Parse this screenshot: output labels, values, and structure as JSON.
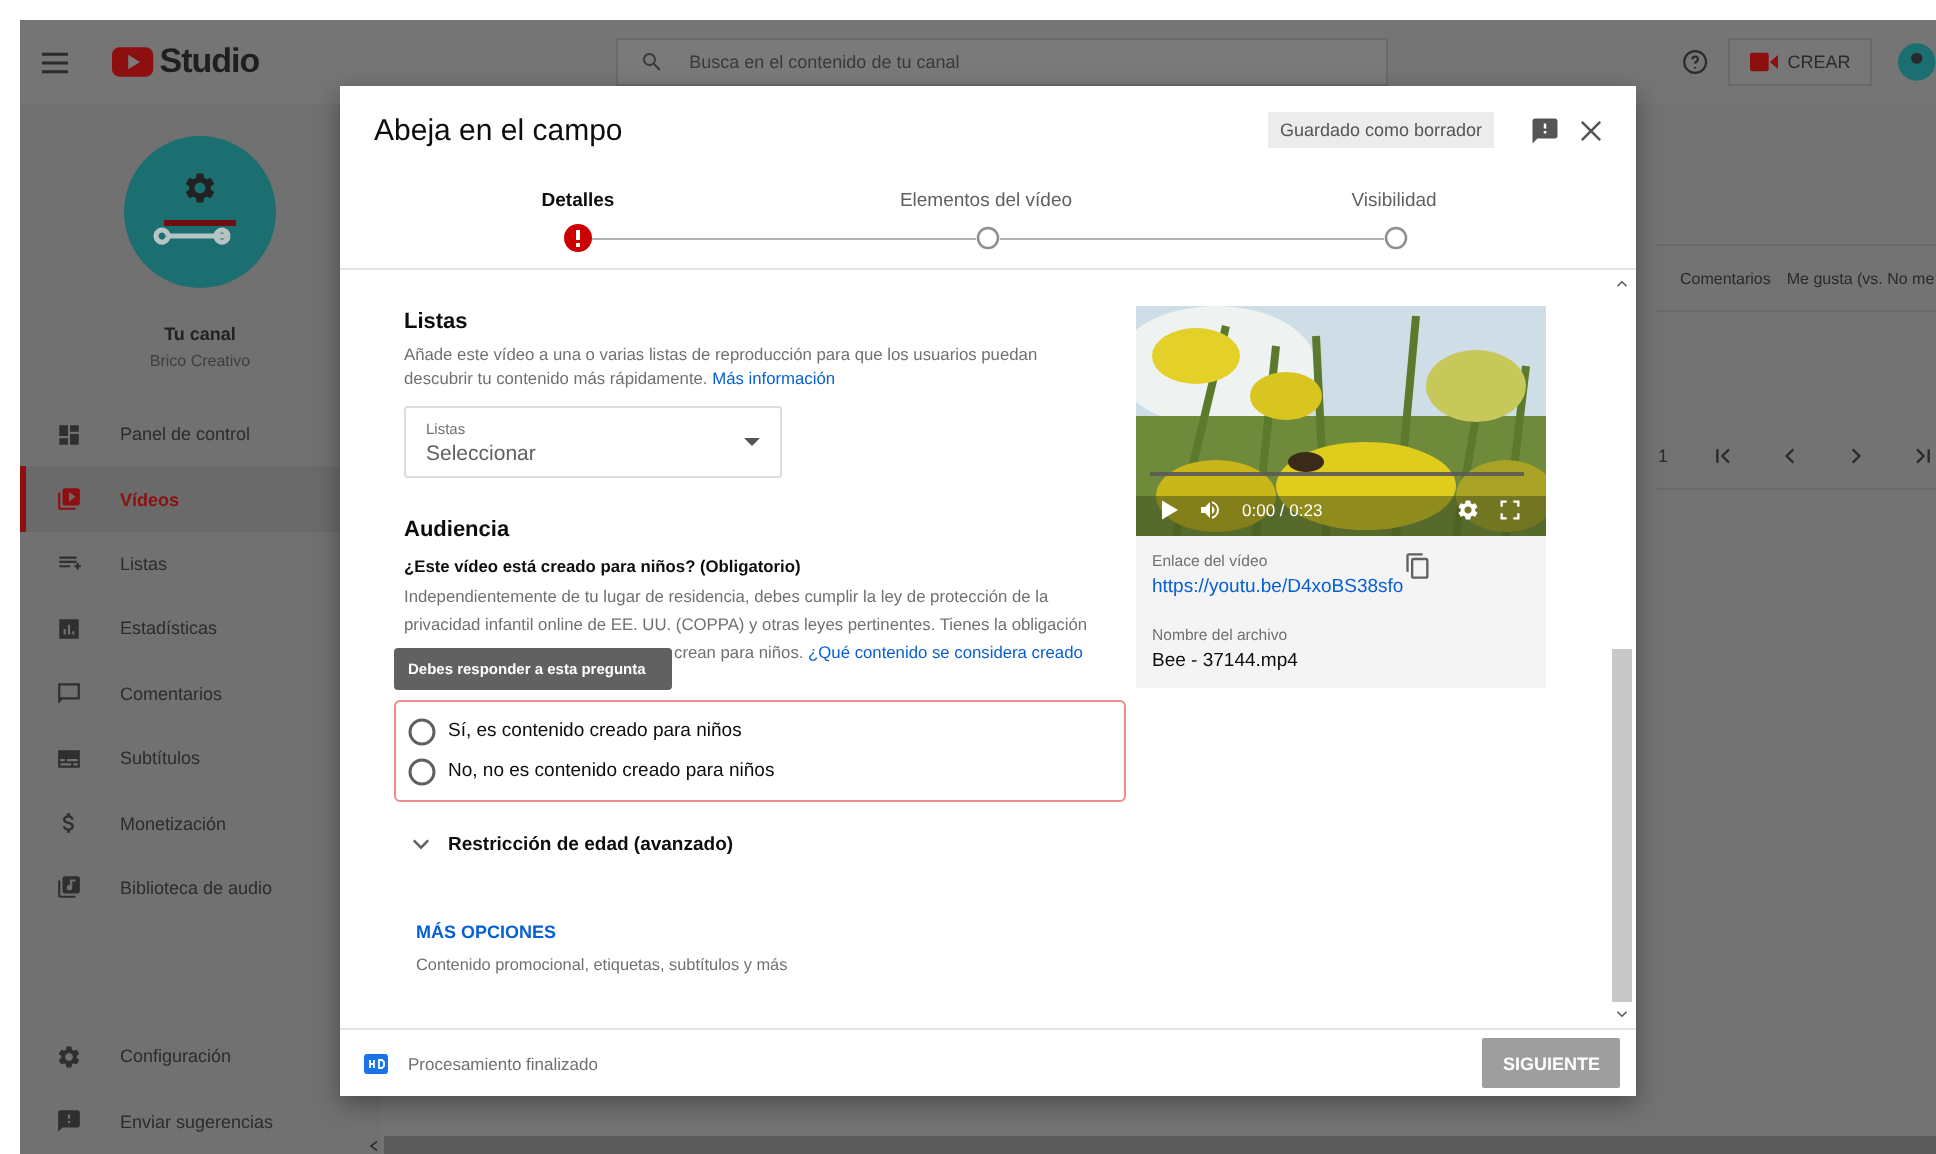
{
  "header": {
    "logo_text": "Studio",
    "search_placeholder": "Busca en el contenido de tu canal",
    "create_label": "CREAR"
  },
  "channel": {
    "title": "Tu canal",
    "name": "Brico Creativo"
  },
  "sidebar": {
    "items": [
      {
        "label": "Panel de control",
        "selected": false
      },
      {
        "label": "Vídeos",
        "selected": true
      },
      {
        "label": "Listas",
        "selected": false
      },
      {
        "label": "Estadísticas",
        "selected": false
      },
      {
        "label": "Comentarios",
        "selected": false
      },
      {
        "label": "Subtítulos",
        "selected": false
      },
      {
        "label": "Monetización",
        "selected": false
      },
      {
        "label": "Biblioteca de audio",
        "selected": false
      }
    ],
    "bottom_items": [
      {
        "label": "Configuración"
      },
      {
        "label": "Enviar sugerencias"
      }
    ]
  },
  "table": {
    "columns": [
      "Comentarios",
      "Me gusta (vs. No me"
    ],
    "pagination": {
      "page": "1"
    }
  },
  "dialog": {
    "title": "Abeja en el campo",
    "draft_badge": "Guardado como borrador",
    "steps": [
      {
        "label": "Detalles",
        "selected": true,
        "error": true
      },
      {
        "label": "Elementos del vídeo",
        "selected": false,
        "error": false
      },
      {
        "label": "Visibilidad",
        "selected": false,
        "error": false
      }
    ],
    "playlists": {
      "heading": "Listas",
      "description": "Añade este vídeo a una o varias listas de reproducción para que los usuarios puedan descubrir tu contenido más rápidamente.",
      "link": "Más información",
      "select": {
        "label": "Listas",
        "value": "Seleccionar"
      }
    },
    "audience": {
      "heading": "Audiencia",
      "question": "¿Este vídeo está creado para niños? (Obligatorio)",
      "paragraph": "Independientemente de tu lugar de residencia, debes cumplir la ley de protección de la privacidad infantil online de EE. UU. (COPPA) y otras leyes pertinentes. Tienes la obligación",
      "paragraph_tail": "crean para niños.",
      "link": "¿Qué contenido se considera creado",
      "tooltip": "Debes responder a esta pregunta",
      "invalid": true,
      "options": [
        {
          "label": "Sí, es contenido creado para niños",
          "selected": false
        },
        {
          "label": "No, no es contenido creado para niños",
          "selected": false
        }
      ]
    },
    "age_restriction": {
      "label": "Restricción de edad (avanzado)",
      "expanded": false
    },
    "more_options": {
      "label": "MÁS OPCIONES",
      "description": "Contenido promocional, etiquetas, subtítulos y más"
    },
    "video": {
      "progress": {
        "level": 0
      },
      "time": "0:00 / 0:23",
      "link_label": "Enlace del vídeo",
      "link": "https://youtu.be/D4xoBS38sfo",
      "file_label": "Nombre del archivo",
      "file_name": "Bee - 37144.mp4"
    },
    "footer": {
      "status": "Procesamiento finalizado",
      "next_button": {
        "label": "SIGUIENTE",
        "disabled": true
      }
    }
  }
}
